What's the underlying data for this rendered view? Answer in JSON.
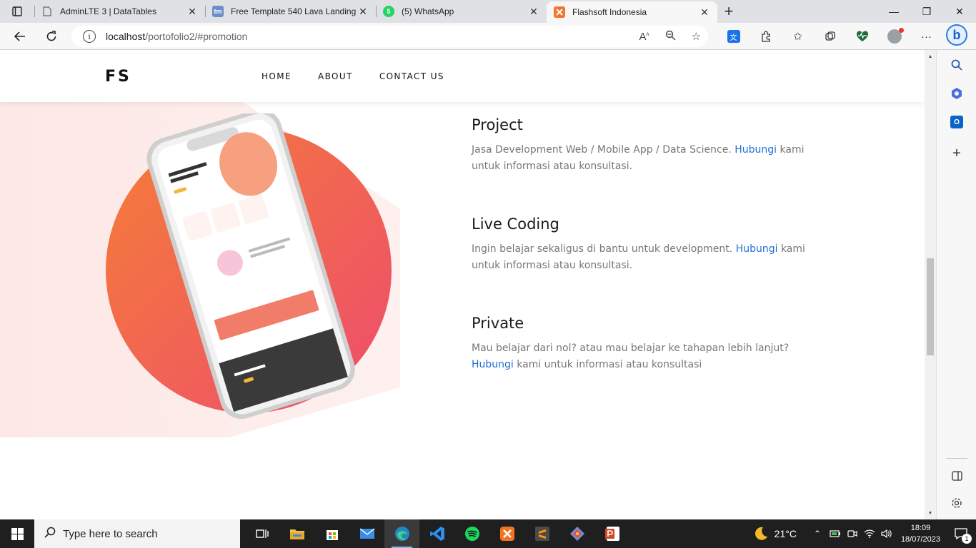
{
  "browser": {
    "tabs": [
      {
        "title": "AdminLTE 3 | DataTables",
        "icon": "page-icon"
      },
      {
        "title": "Free Template 540 Lava Landing",
        "icon": "tm-icon"
      },
      {
        "title": "(5) WhatsApp",
        "icon": "whatsapp-icon",
        "badge": "5"
      },
      {
        "title": "Flashsoft Indonesia",
        "icon": "flashsoft-icon",
        "active": true
      }
    ],
    "url_host": "localhost",
    "url_path": "/portofolio2/#promotion",
    "tm_label": "tm"
  },
  "site": {
    "logo": "FS",
    "menu": [
      "HOME",
      "ABOUT",
      "CONTACT US"
    ]
  },
  "features": [
    {
      "title": "Project",
      "text_before": "Jasa Development Web / Mobile App / Data Science. ",
      "link": "Hubungi",
      "text_after": " kami untuk informasi atau konsultasi."
    },
    {
      "title": "Live Coding",
      "text_before": "Ingin belajar sekaligus di bantu untuk development. ",
      "link": "Hubungi",
      "text_after": " kami untuk informasi atau konsultasi."
    },
    {
      "title": "Private",
      "text_before": "Mau belajar dari nol? atau mau belajar ke tahapan lebih lanjut? ",
      "link": "Hubungi",
      "text_after": " kami untuk informasi atau konsultasi"
    }
  ],
  "taskbar": {
    "search_placeholder": "Type here to search",
    "weather": "21°C",
    "time": "18:09",
    "date": "18/07/2023",
    "notifications": "1"
  },
  "colors": {
    "accent_link": "#1f6fd6",
    "circle_start": "#f37a3c",
    "circle_end": "#ef506b",
    "bg_tint": "#fdeceb"
  }
}
